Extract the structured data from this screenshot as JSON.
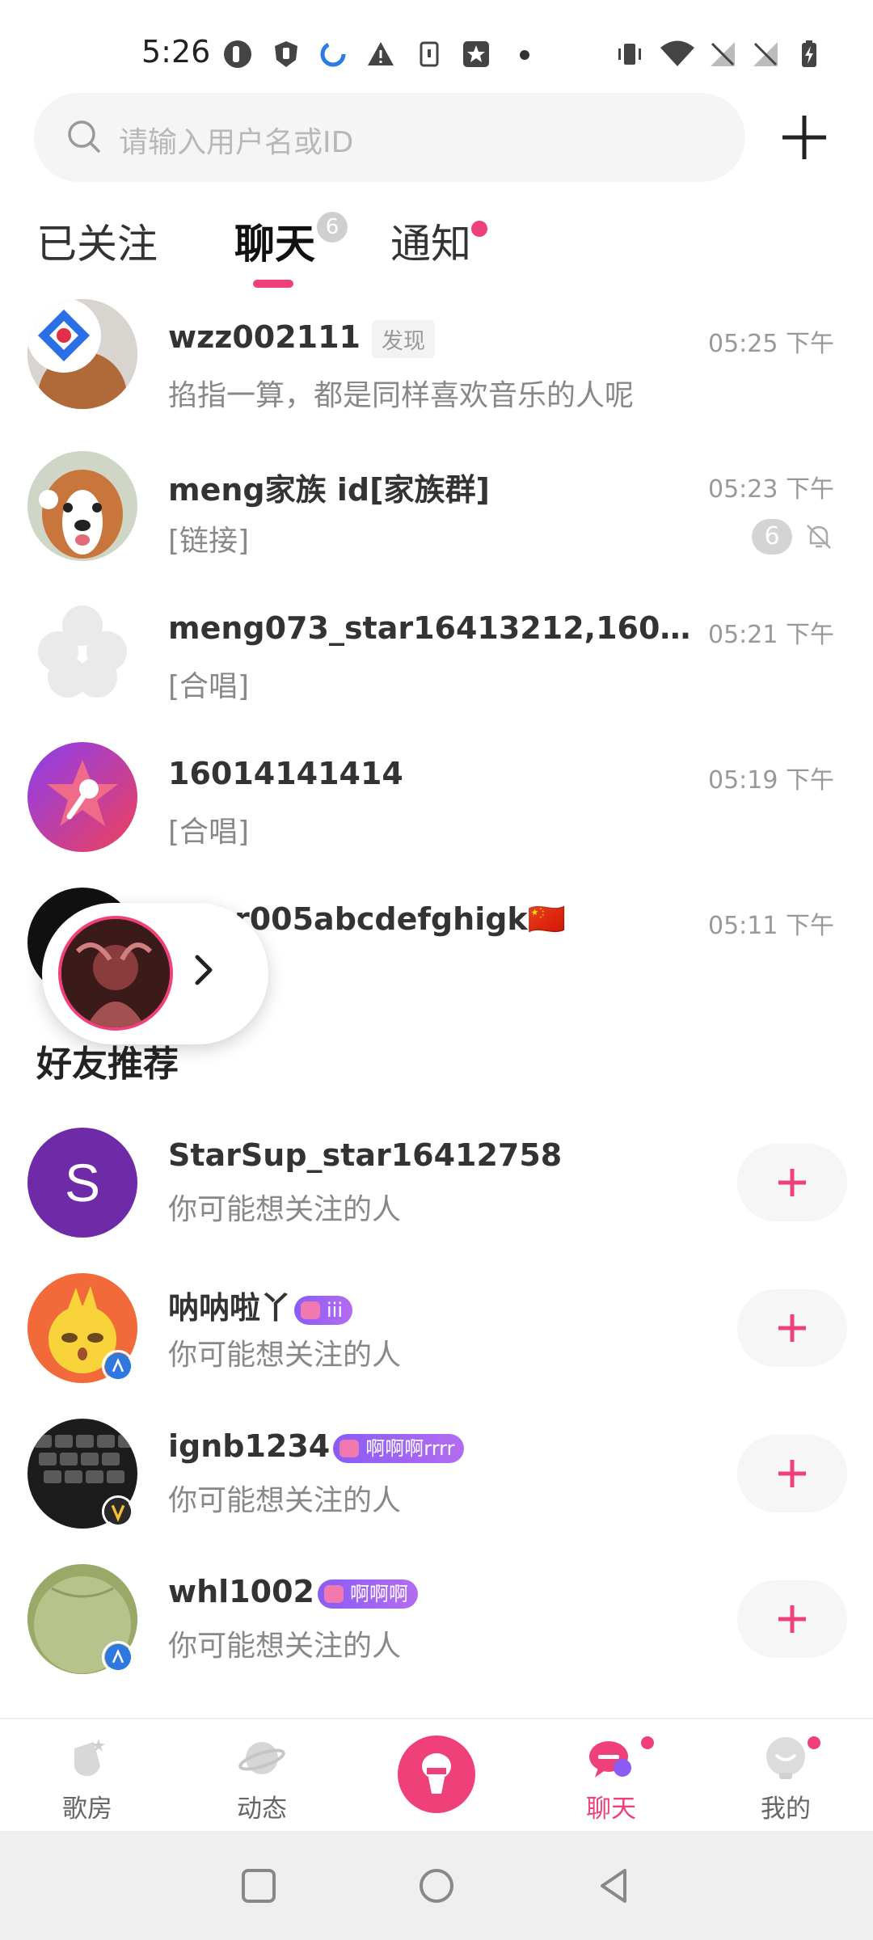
{
  "status_bar": {
    "time": "5:26"
  },
  "search": {
    "placeholder": "请输入用户名或ID"
  },
  "tabs": [
    {
      "label": "已关注"
    },
    {
      "label": "聊天",
      "badge": "6"
    },
    {
      "label": "通知"
    }
  ],
  "chats": [
    {
      "name": "wzz002111",
      "tag": "发现",
      "preview": "掐指一算，都是同样喜欢音乐的人呢",
      "time": "05:25 下午"
    },
    {
      "name": "meng家族 id[家族群]",
      "preview": "[链接]",
      "time": "05:23 下午",
      "unread": "6"
    },
    {
      "name": "meng073_star16413212,16058585...",
      "preview": "[合唱]",
      "time": "05:21 下午"
    },
    {
      "name": "16014141414",
      "preview": "[合唱]",
      "time": "05:19 下午"
    },
    {
      "name": "r005abcdefghigk🇨🇳",
      "preview": "",
      "time": "05:11 下午"
    }
  ],
  "recommend": {
    "title": "好友推荐",
    "items": [
      {
        "name": "StarSup_star16412758",
        "subtitle": "你可能想关注的人",
        "avatar_letter": "S"
      },
      {
        "name": "呐呐啦丫",
        "badge": "iii",
        "subtitle": "你可能想关注的人"
      },
      {
        "name": "ignb1234",
        "badge": "啊啊啊rrrr",
        "subtitle": "你可能想关注的人"
      },
      {
        "name": "whl1002",
        "badge": "啊啊啊",
        "subtitle": "你可能想关注的人"
      }
    ]
  },
  "bottom_nav": [
    {
      "label": "歌房",
      "icon": "song-room-icon"
    },
    {
      "label": "动态",
      "icon": "planet-icon"
    },
    {
      "label": "",
      "icon": "microphone-icon"
    },
    {
      "label": "聊天",
      "icon": "chat-icon",
      "active": true
    },
    {
      "label": "我的",
      "icon": "profile-icon"
    }
  ],
  "colors": {
    "accent": "#f0407a",
    "tab_indicator": "#f0407a"
  }
}
